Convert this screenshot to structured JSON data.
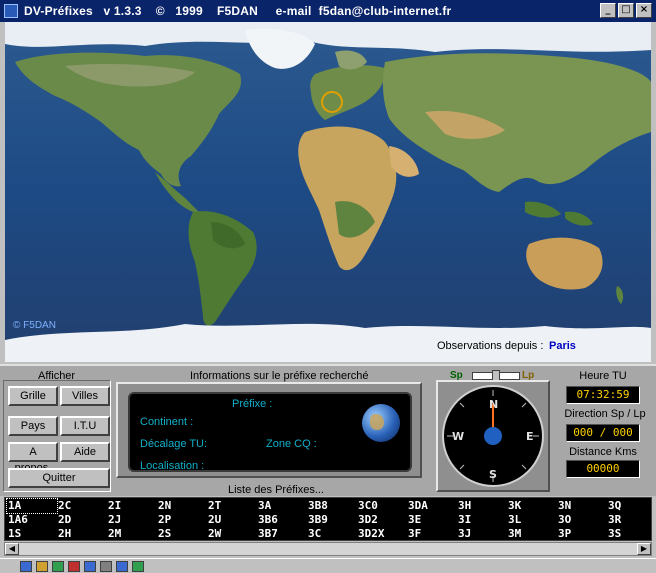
{
  "window": {
    "title": "DV-Préfixes   v 1.3.3    ©   1999    F5DAN     e-mail  f5dan@club-internet.fr",
    "controls": {
      "minimize": "_",
      "maximize": "□",
      "close": "×"
    }
  },
  "map": {
    "copyright": "© F5DAN",
    "observations_label": "Observations depuis :",
    "observations_city": "Paris"
  },
  "afficher": {
    "title": "Afficher",
    "buttons": {
      "grille": "Grille",
      "villes": "Villes",
      "pays": "Pays",
      "itu": "I.T.U",
      "apropos": "A propos.",
      "aide": "Aide",
      "quitter": "Quitter"
    }
  },
  "info": {
    "title": "Informations sur le préfixe recherché",
    "prefixe": "Préfixe :",
    "continent": "Continent :",
    "decalage": "Décalage TU:",
    "zone_cq": "Zone CQ :",
    "localisation": "Localisation :"
  },
  "compass": {
    "sp": "Sp",
    "lp": "Lp",
    "n": "N",
    "s": "S",
    "e": "E",
    "w": "W"
  },
  "readouts": {
    "heure_label": "Heure TU",
    "heure_value": "07:32:59",
    "direction_label": "Direction Sp / Lp",
    "direction_value": "000 / 000",
    "distance_label": "Distance Kms",
    "distance_value": "00000"
  },
  "prefix_list": {
    "title": "Liste des Préfixes...",
    "rows": [
      [
        "1A",
        "2C",
        "2I",
        "2N",
        "2T",
        "3A",
        "3B8",
        "3C0",
        "3DA",
        "3H",
        "3K",
        "3N",
        "3Q"
      ],
      [
        "1A6",
        "2D",
        "2J",
        "2P",
        "2U",
        "3B6",
        "3B9",
        "3D2",
        "3E",
        "3I",
        "3L",
        "3O",
        "3R"
      ],
      [
        "1S",
        "2H",
        "2M",
        "2S",
        "2W",
        "3B7",
        "3C",
        "3D2X",
        "3F",
        "3J",
        "3M",
        "3P",
        "3S"
      ]
    ]
  }
}
